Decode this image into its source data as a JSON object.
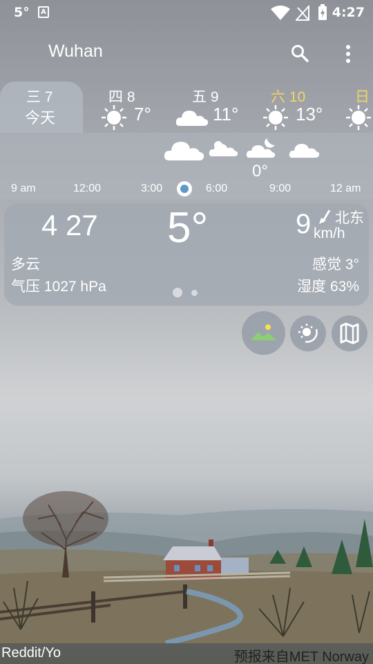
{
  "status_bar": {
    "temp": "5°",
    "time": "4:27",
    "a_icon": "A"
  },
  "header": {
    "city": "Wuhan"
  },
  "days": [
    {
      "label": "三 7",
      "sub": "今天",
      "temp": "",
      "icon": "none"
    },
    {
      "label": "四 8",
      "temp": "7°",
      "icon": "sun-icon"
    },
    {
      "label": "五 9",
      "temp": "11°",
      "icon": "cloud-icon"
    },
    {
      "label": "六 10",
      "temp": "13°",
      "icon": "sun-icon",
      "label_color": "#f3d36a"
    },
    {
      "label": "日",
      "temp": "",
      "icon": "sun-icon",
      "label_color": "#f3d36a"
    }
  ],
  "hourly": {
    "times": [
      "9 am",
      "12:00",
      "3:00",
      "6:00",
      "9:00",
      "12 am"
    ],
    "temp": "0°"
  },
  "current": {
    "time": "4 27",
    "temp": "5°",
    "wind_speed": "9",
    "wind_dir": "北东",
    "wind_unit": "km/h",
    "condition": "多云",
    "feels_like": "感觉 3°",
    "pressure": "气压 1027 hPa",
    "humidity": "湿度 63%"
  },
  "footer": {
    "credit": "Reddit/Yo",
    "source": "预报来自MET Norway"
  }
}
